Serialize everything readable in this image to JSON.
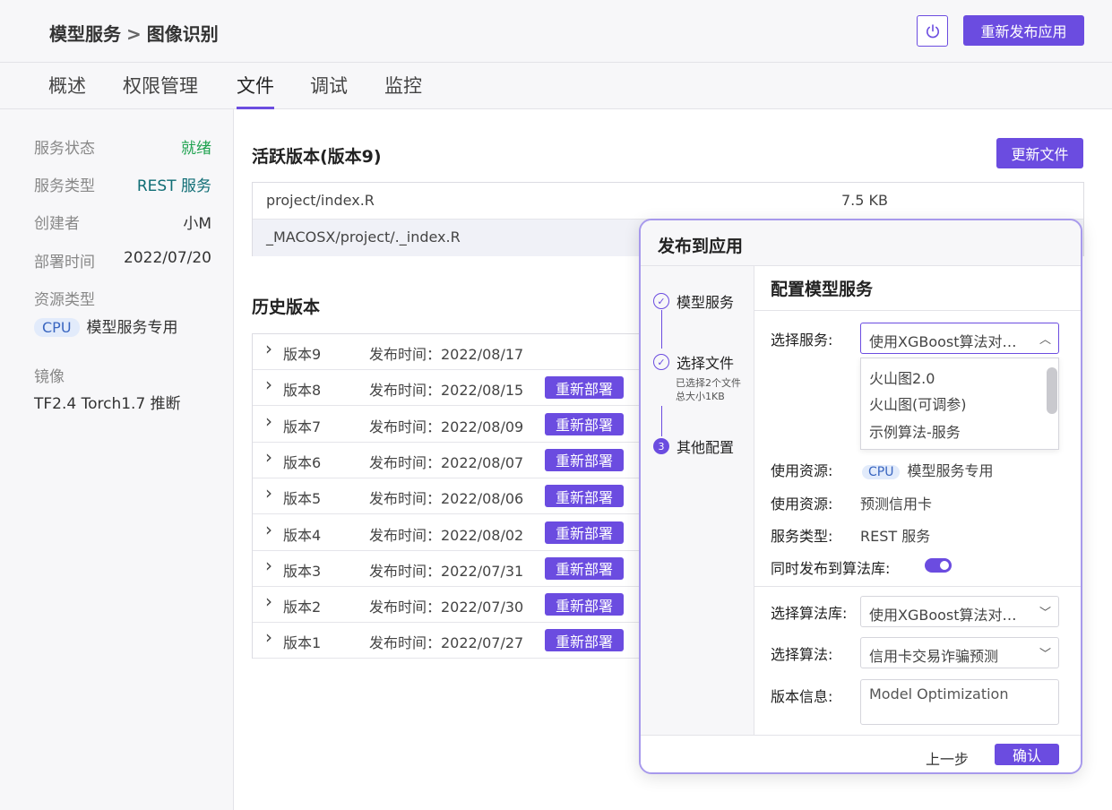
{
  "header": {
    "breadcrumb_parent": "模型服务",
    "breadcrumb_sep": ">",
    "breadcrumb_current": "图像识别",
    "republish_label": "重新发布应用",
    "power_icon": "power-icon"
  },
  "tabs": [
    {
      "label": "概述"
    },
    {
      "label": "权限管理"
    },
    {
      "label": "文件"
    },
    {
      "label": "调试"
    },
    {
      "label": "监控"
    }
  ],
  "sidebar": {
    "status_key": "服务状态",
    "status_val": "就绪",
    "type_key": "服务类型",
    "type_val": "REST 服务",
    "creator_key": "创建者",
    "creator_val": "小M",
    "deploy_key": "部署时间",
    "deploy_val": "2022/07/20",
    "resource_key": "资源类型",
    "resource_badge": "CPU",
    "resource_val": "模型服务专用",
    "image_key": "镜像",
    "image_val": "TF2.4 Torch1.7 推断"
  },
  "active": {
    "title": "活跃版本(版本9)",
    "update_label": "更新文件",
    "files": [
      {
        "name": "project/index.R",
        "size": "7.5 KB"
      },
      {
        "name": "_MACOSX/project/._index.R",
        "size": ""
      }
    ]
  },
  "history": {
    "title": "历史版本",
    "redeploy_label": "重新部署",
    "rows": [
      {
        "version": "版本9",
        "time": "发布时间：2022/08/17",
        "redeploy": false
      },
      {
        "version": "版本8",
        "time": "发布时间：2022/08/15",
        "redeploy": true
      },
      {
        "version": "版本7",
        "time": "发布时间：2022/08/09",
        "redeploy": true
      },
      {
        "version": "版本6",
        "time": "发布时间：2022/08/07",
        "redeploy": true
      },
      {
        "version": "版本5",
        "time": "发布时间：2022/08/06",
        "redeploy": true
      },
      {
        "version": "版本4",
        "time": "发布时间：2022/08/02",
        "redeploy": true
      },
      {
        "version": "版本3",
        "time": "发布时间：2022/07/31",
        "redeploy": true
      },
      {
        "version": "版本2",
        "time": "发布时间：2022/07/30",
        "redeploy": true
      },
      {
        "version": "版本1",
        "time": "发布时间：2022/07/27",
        "redeploy": true
      }
    ]
  },
  "modal": {
    "title": "发布到应用",
    "steps": [
      {
        "label": "模型服务",
        "state": "done"
      },
      {
        "label": "选择文件",
        "state": "done",
        "sub1": "已选择2个文件",
        "sub2": "总大小1KB"
      },
      {
        "label": "其他配置",
        "state": "current",
        "num": "3"
      }
    ],
    "section_title": "配置模型服务",
    "select_service_label": "选择服务:",
    "select_service_value": "使用XGBoost算法对信用卡交易诈骗进行预测",
    "dropdown_options": [
      "火山图2.0",
      "火山图(可调参)",
      "示例算法-服务"
    ],
    "resource_label": "使用资源:",
    "resource_badge": "CPU",
    "resource_value": "模型服务专用",
    "resource2_label": "使用资源:",
    "resource2_value": "预测信用卡",
    "service_type_label": "服务类型:",
    "service_type_value": "REST 服务",
    "publish_lib_label": "同时发布到算法库:",
    "publish_lib_on": true,
    "lib_label": "选择算法库:",
    "lib_value": "使用XGBoost算法对信用卡交易诈骗进行预测",
    "algo_label": "选择算法:",
    "algo_value": "信用卡交易诈骗预测",
    "version_label": "版本信息:",
    "version_value": "Model Optimization",
    "prev_label": "上一步",
    "confirm_label": "确认"
  },
  "colors": {
    "accent": "#6b4ce0",
    "success": "#1ea24f",
    "teal": "#0f6d75"
  }
}
